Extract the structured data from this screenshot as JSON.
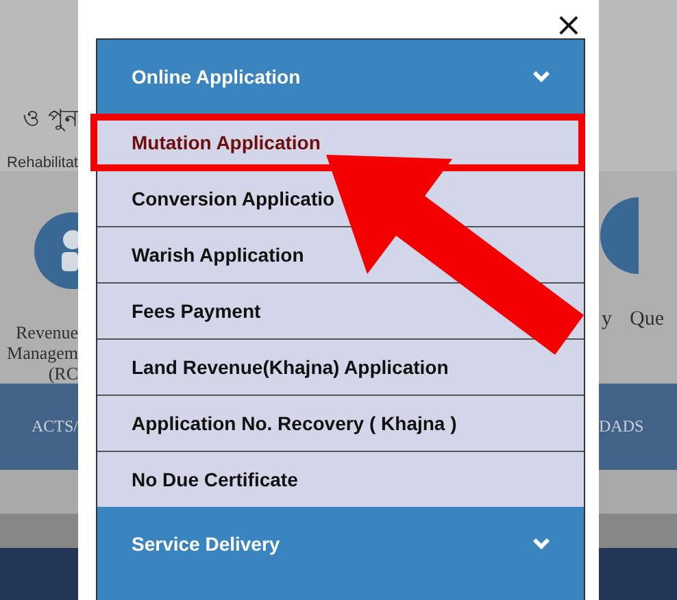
{
  "backdrop": {
    "header_left": [
      "ও পুন",
      "Rehabilitat"
    ],
    "tile_left": [
      "Revenue",
      "Managem",
      "(RC"
    ],
    "tile_right": [
      "y",
      "Que"
    ],
    "nav_left": "ACTS/",
    "nav_right": "DADS"
  },
  "modal": {
    "close": "×",
    "sections": [
      {
        "title": "Online Application",
        "items": [
          {
            "label": "Mutation Application",
            "selected": true
          },
          {
            "label": "Conversion Applicatio",
            "selected": false
          },
          {
            "label": "Warish Application",
            "selected": false
          },
          {
            "label": "Fees Payment",
            "selected": false
          },
          {
            "label": "Land Revenue(Khajna) Application",
            "selected": false
          },
          {
            "label": "Application No. Recovery ( Khajna )",
            "selected": false
          },
          {
            "label": "No Due Certificate",
            "selected": false
          }
        ]
      },
      {
        "title": "Service Delivery"
      }
    ]
  },
  "annotations": {
    "highlight_box": true,
    "arrow": true
  }
}
